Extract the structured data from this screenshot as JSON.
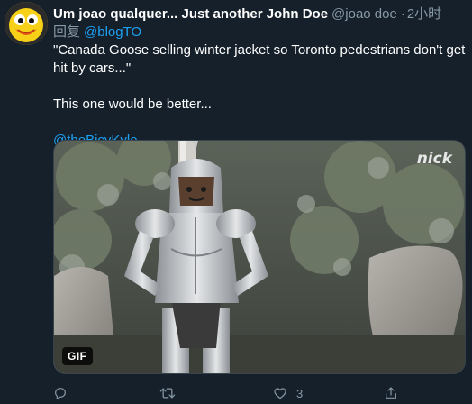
{
  "user": {
    "display_name": "Um joao qualquer... Just another John Doe",
    "handle": "@joao  doe",
    "separator": "·",
    "time": "2小时"
  },
  "reply": {
    "prefix": "回复",
    "mention": "@blogTO"
  },
  "tweet": {
    "line1": "\"Canada Goose selling winter jacket so Toronto pedestrians don't get hit by cars...\"",
    "line2": "This one would be better...",
    "link": "@theBicyKyle"
  },
  "media": {
    "type": "gif",
    "badge": "GIF",
    "watermark": "nick"
  },
  "actions": {
    "reply_icon": "reply-icon",
    "retweet_icon": "retweet-icon",
    "like_icon": "heart-icon",
    "like_count": "3",
    "share_icon": "share-icon"
  },
  "colors": {
    "background": "#15202b",
    "secondary_text": "#8899a6",
    "link": "#1da1f2",
    "border": "#38444d",
    "avatar": "#f7d117"
  }
}
